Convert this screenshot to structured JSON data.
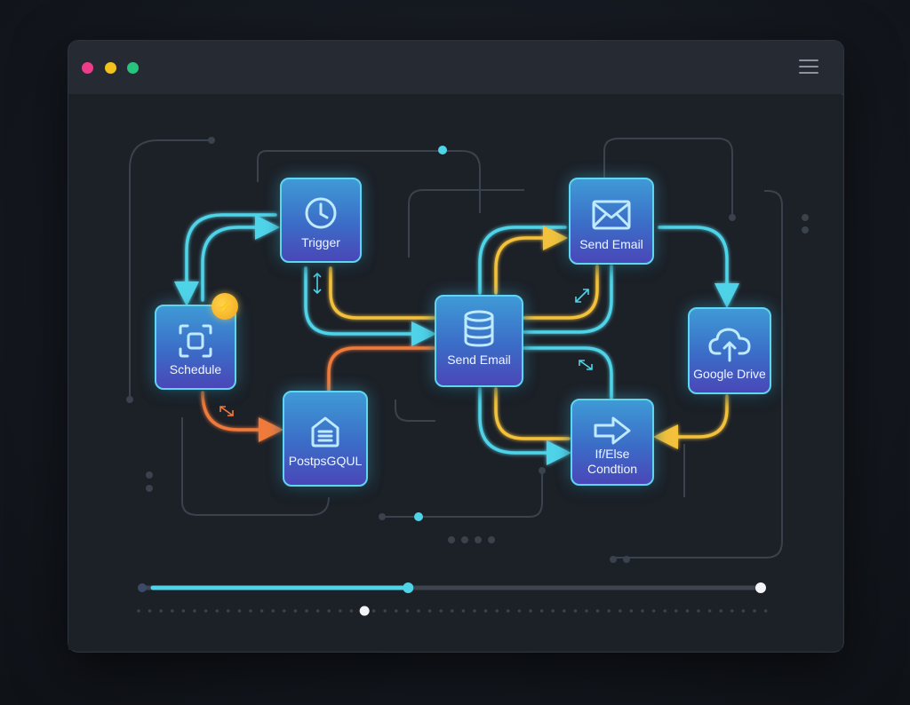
{
  "window": {
    "controls": [
      "close",
      "minimize",
      "maximize"
    ],
    "menu_icon": "hamburger-menu-icon"
  },
  "nodes": {
    "trigger": {
      "label": "Trigger",
      "icon": "clock-icon"
    },
    "schedule": {
      "label": "Schedule",
      "icon": "scan-frame-icon",
      "badge_icon": "lightning-icon"
    },
    "postgres": {
      "label": "PostpsGQUL",
      "icon": "database-archive-icon"
    },
    "send_email_center": {
      "label": "Send Email",
      "icon": "database-icon"
    },
    "send_email_top": {
      "label": "Send Email",
      "icon": "envelope-icon"
    },
    "google_drive": {
      "label": "Google Drive",
      "icon": "cloud-upload-icon"
    },
    "if_else": {
      "label": "If/Else\nCondtion",
      "label_line1": "If/Else",
      "label_line2": "Condtion",
      "icon": "arrow-right-icon"
    }
  },
  "colors": {
    "connector_cyan": "#4fd3e8",
    "connector_yellow": "#f3c13a",
    "connector_orange": "#f07a3a",
    "node_border": "#5fd6f0",
    "progress": "#4fd3e8"
  },
  "timeline": {
    "progress": 0.43,
    "marker": 0.36
  }
}
